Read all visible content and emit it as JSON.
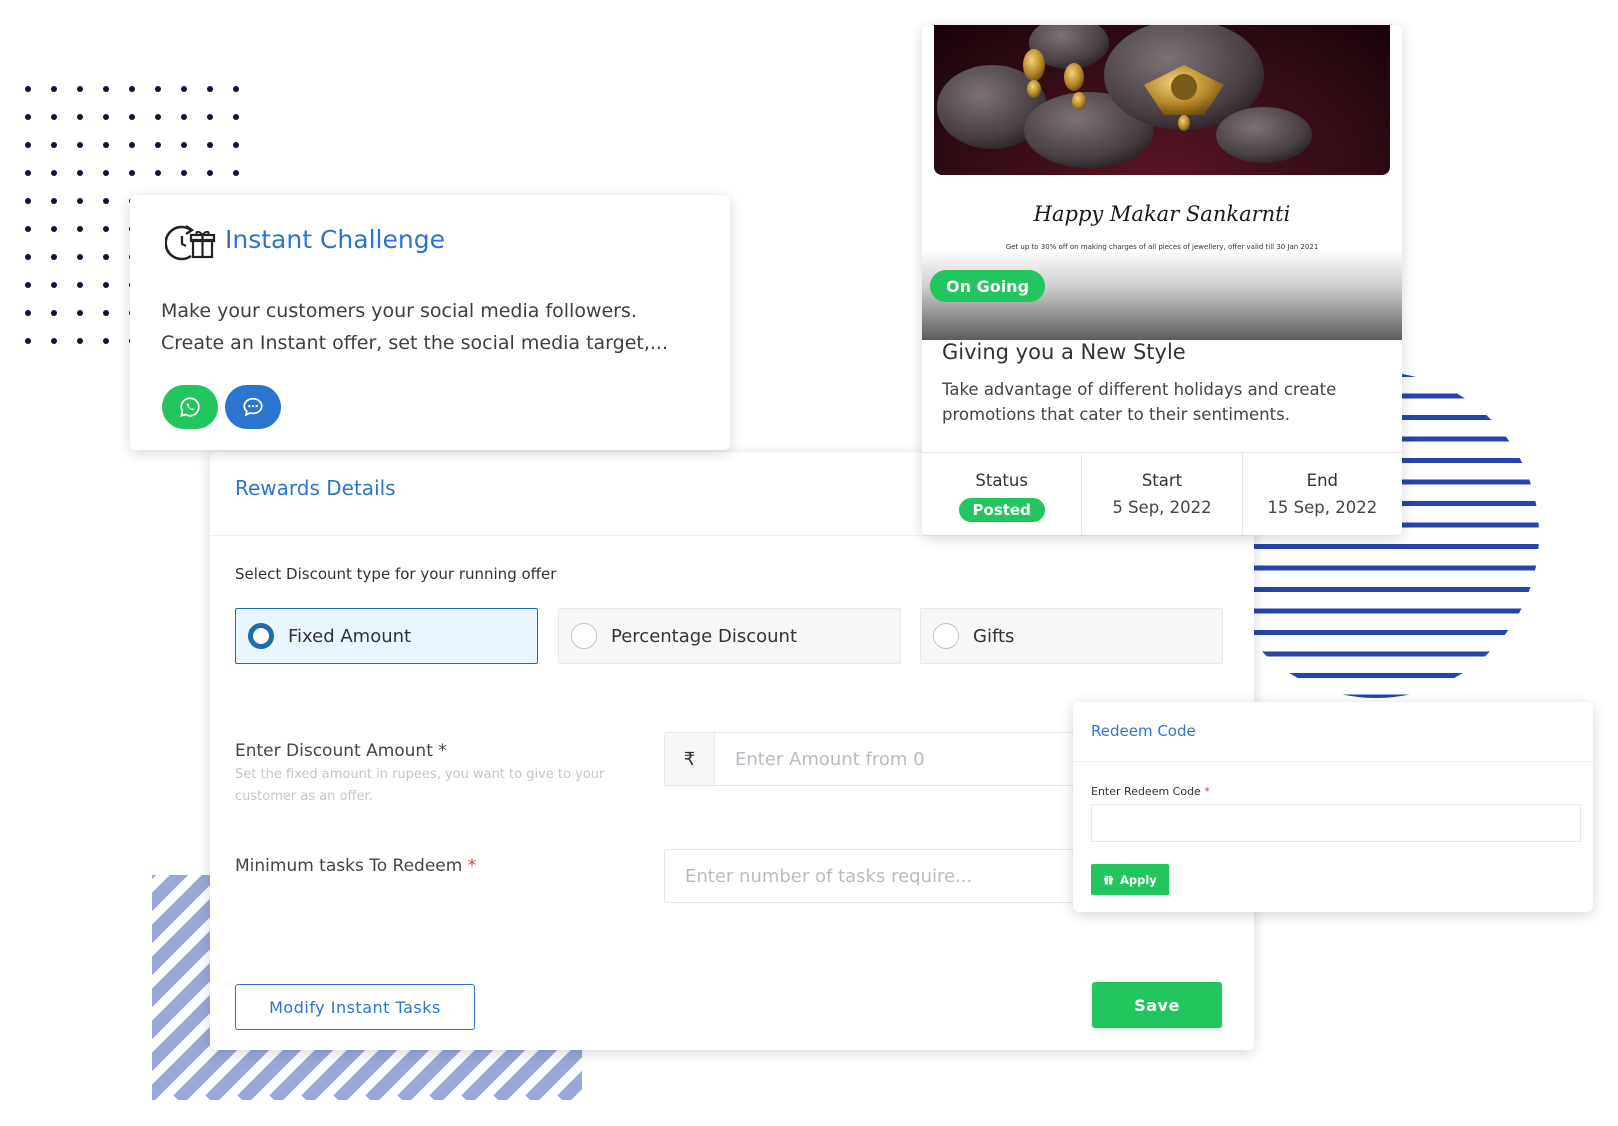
{
  "challenge": {
    "title": "Instant Challenge",
    "description": "Make your customers your social media followers. Create an Instant offer, set the social media target,...",
    "icons": [
      "timer-gift-icon",
      "whatsapp-icon",
      "chat-icon"
    ]
  },
  "promo": {
    "image_heading": "Happy Makar Sankarnti",
    "image_subtext": "Get up to 30% off on making charges of all pieces of jewellery, offer valid till 30 Jan 2021",
    "badge": "On Going",
    "title": "Giving you a New Style",
    "description": "Take advantage of different holidays and create promotions that cater to their sentiments.",
    "status_label": "Status",
    "status_value": "Posted",
    "start_label": "Start",
    "start_value": "5 Sep, 2022",
    "end_label": "End",
    "end_value": "15 Sep, 2022"
  },
  "rewards": {
    "title": "Rewards Details",
    "select_label": "Select Discount type for your running offer",
    "options": [
      {
        "label": "Fixed Amount",
        "selected": true
      },
      {
        "label": "Percentage Discount",
        "selected": false
      },
      {
        "label": "Gifts",
        "selected": false
      }
    ],
    "amount_label": "Enter Discount Amount",
    "amount_required": "*",
    "amount_hint": "Set the fixed amount in rupees, you want to give to your customer as an offer.",
    "currency_symbol": "₹",
    "amount_placeholder": "Enter Amount from 0",
    "tasks_label": "Minimum tasks To Redeem",
    "tasks_required": "*",
    "tasks_placeholder": "Enter number of tasks require...",
    "modify_button": "Modify Instant Tasks",
    "save_button": "Save"
  },
  "redeem": {
    "title": "Redeem Code",
    "label": "Enter Redeem Code",
    "required": "*",
    "apply_button": "Apply"
  },
  "colors": {
    "accent": "#2b74d0",
    "success": "#22c55e",
    "selected_border": "#1d6fa8",
    "stripes_blue": "#2446a8",
    "stripes_light": "#9aa8d8"
  }
}
